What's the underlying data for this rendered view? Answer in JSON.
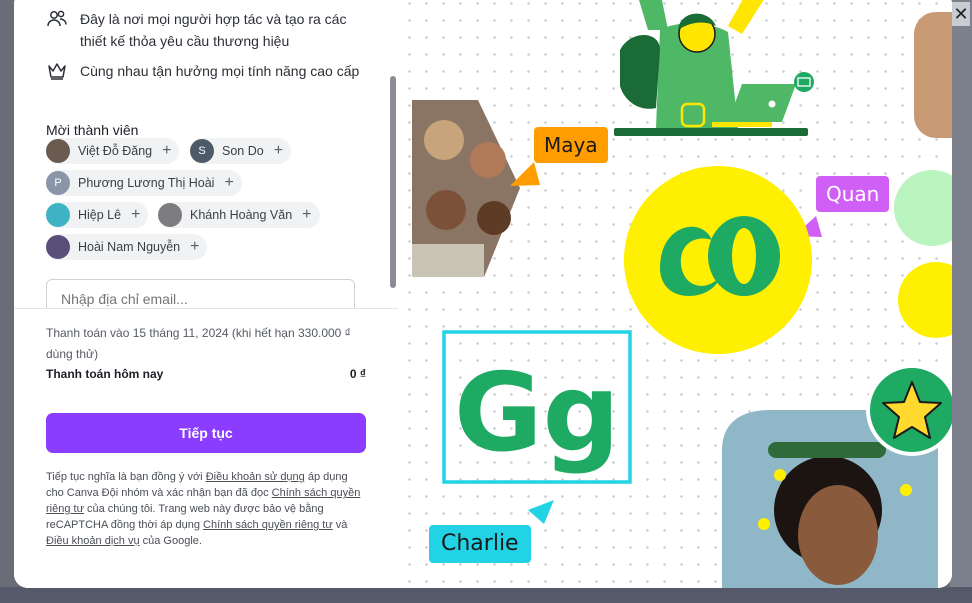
{
  "features": [
    {
      "icon": "people-icon",
      "text": "Đây là nơi mọi người hợp tác và tạo ra các thiết kế thỏa yêu cầu thương hiệu"
    },
    {
      "icon": "crown-icon",
      "text": "Cùng nhau tận hưởng mọi tính năng cao cấp"
    }
  ],
  "invite": {
    "title": "Mời thành viên",
    "members": [
      {
        "name": "Việt Đỗ Đăng",
        "initial": "",
        "color": "#6b5a50"
      },
      {
        "name": "Son Do",
        "initial": "S",
        "color": "#4d5b68"
      },
      {
        "name": "Phương Lương Thị Hoài",
        "initial": "P",
        "color": "#8a96a8"
      },
      {
        "name": "Hiệp Lê",
        "initial": "",
        "color": "#3eb3c4"
      },
      {
        "name": "Khánh Hoàng Văn",
        "initial": "",
        "color": "#7d7d80"
      },
      {
        "name": "Hoài Nam Nguyễn",
        "initial": "",
        "color": "#5a4e7a"
      }
    ],
    "email_placeholder": "Nhập địa chỉ email..."
  },
  "payment": {
    "note": "Thanh toán vào 15 tháng 11, 2024 (khi hết hạn 330.000 ₫ dùng thử)",
    "today_label": "Thanh toán hôm nay",
    "today_value": "0 ₫",
    "continue_label": "Tiếp tục"
  },
  "legal": {
    "p1": "Tiếp tục nghĩa là bạn đồng ý với ",
    "terms": "Điều khoản sử dụng",
    "p2": " áp dụng cho Canva Đội nhóm và xác nhận bạn đã đọc ",
    "privacy": "Chính sách quyền riêng tư",
    "p3": " của chúng tôi. Trang web này được bảo vệ bằng reCAPTCHA đồng thời áp dụng ",
    "privacy2": "Chính sách quyền riêng tư",
    "p4": " và ",
    "tos": "Điều khoản dịch vụ",
    "p5": " của Google."
  },
  "illustration": {
    "tags": [
      {
        "name": "Maya",
        "color": "#ff9d00"
      },
      {
        "name": "Quan",
        "color": "#cf5ff5"
      },
      {
        "name": "Charlie",
        "color": "#22d3e6"
      }
    ],
    "letters": "Gg"
  },
  "colors": {
    "accent": "#8b3dff",
    "green": "#1faa63",
    "yellow": "#ffef00"
  }
}
